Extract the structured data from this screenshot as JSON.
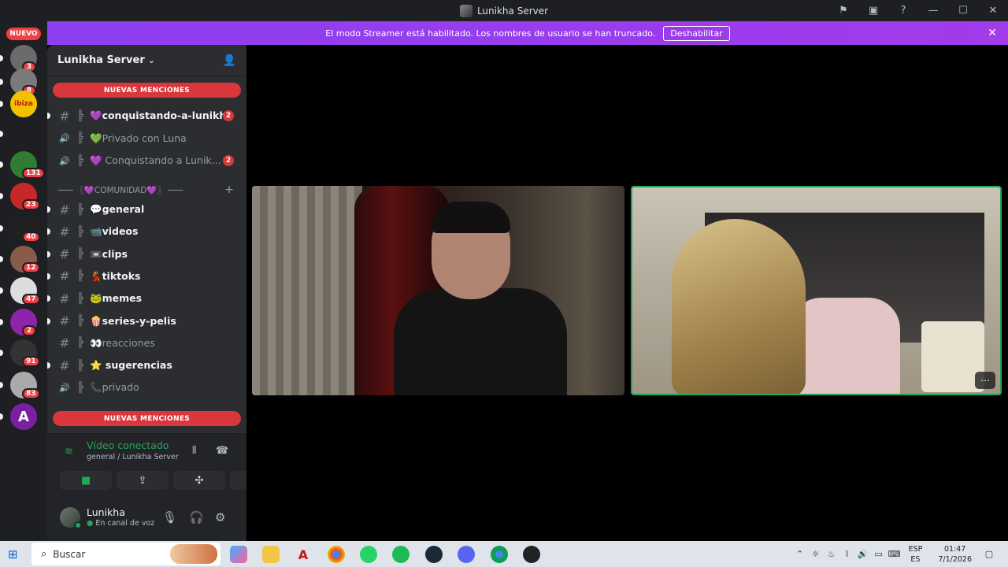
{
  "window": {
    "title": "Lunikha Server"
  },
  "banner": {
    "text": "El modo Streamer está habilitado. Los nombres de usuario se han truncado.",
    "button": "Deshabilitar"
  },
  "rail": {
    "new_label": "NUEVO",
    "servers": [
      {
        "badge": "3"
      },
      {
        "badge": "8"
      },
      {
        "badge": "",
        "label": "ibiza"
      },
      {
        "badge": ""
      },
      {
        "badge": "131"
      },
      {
        "badge": "23"
      },
      {
        "badge": "40"
      },
      {
        "badge": "12"
      },
      {
        "badge": "47"
      },
      {
        "badge": "2"
      },
      {
        "badge": "91"
      },
      {
        "badge": "83"
      },
      {
        "badge": "",
        "label": "A"
      }
    ]
  },
  "sidebar": {
    "server_name": "Lunikha Server",
    "mentions_label": "NUEVAS MENCIONES",
    "channels_top": [
      {
        "type": "text",
        "name": "💜conquistando-a-lunikha",
        "badge": "2",
        "state": "bright"
      },
      {
        "type": "voice",
        "name": "💚Privado con Luna",
        "badge": "",
        "state": "muted"
      },
      {
        "type": "voice",
        "name": "💜 Conquistando a Lunik...",
        "badge": "2",
        "state": "muted"
      }
    ],
    "category": "─── 〖💜COMUNIDAD💜〗 ───",
    "channels": [
      {
        "type": "text",
        "name": "💬general",
        "state": "bright"
      },
      {
        "type": "text",
        "name": "📹videos",
        "state": "bright"
      },
      {
        "type": "text",
        "name": "📼clips",
        "state": "bright"
      },
      {
        "type": "text",
        "name": "💃tiktoks",
        "state": "bright"
      },
      {
        "type": "text",
        "name": "🐸memes",
        "state": "bright"
      },
      {
        "type": "text",
        "name": "🍿series-y-pelis",
        "state": "bright"
      },
      {
        "type": "text",
        "name": "👀reacciones",
        "state": "muted"
      },
      {
        "type": "text",
        "name": "⭐ sugerencias",
        "state": "bright"
      },
      {
        "type": "voice",
        "name": "📞privado",
        "state": "muted"
      }
    ]
  },
  "voice": {
    "status": "Vídeo conectado",
    "location": "general / Lunikha Server"
  },
  "user": {
    "name": "Lunikha",
    "status": "En canal de voz"
  },
  "taskbar": {
    "search_placeholder": "Buscar",
    "lang_top": "ESP",
    "lang_bottom": "ES",
    "time": "01:47",
    "date": "7/1/2026"
  }
}
